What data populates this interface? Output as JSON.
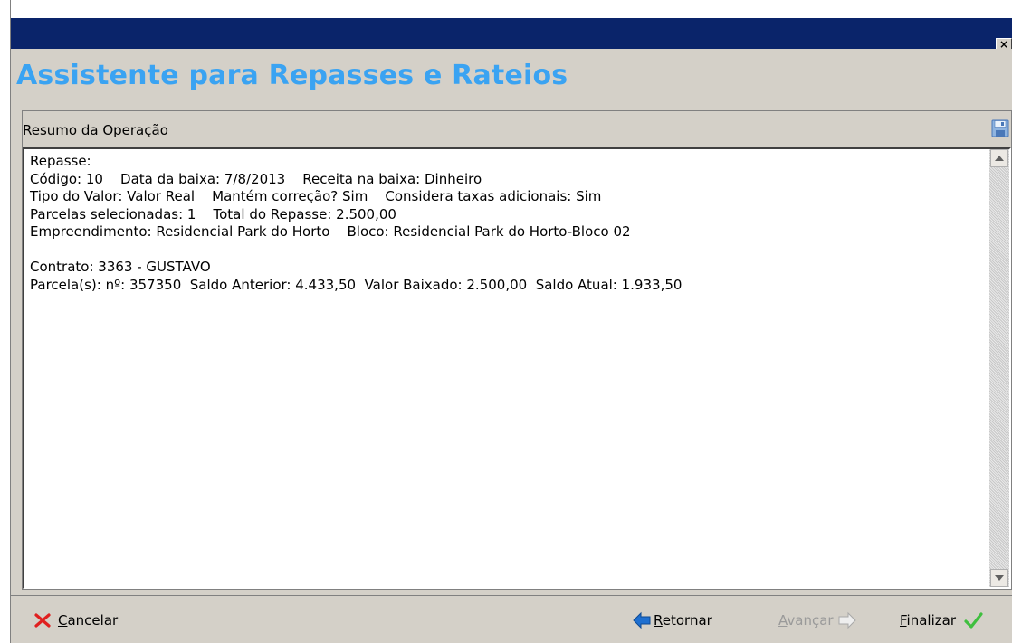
{
  "window": {
    "close_glyph": "×"
  },
  "header": {
    "title": "Assistente para Repasses e Rateios"
  },
  "panel": {
    "title": "Resumo da Operação",
    "save_icon": "save-icon",
    "lines": [
      "Repasse:",
      "Código: 10    Data da baixa: 7/8/2013    Receita na baixa: Dinheiro",
      "Tipo do Valor: Valor Real    Mantém correção? Sim    Considera taxas adicionais: Sim",
      "Parcelas selecionadas: 1    Total do Repasse: 2.500,00",
      "Empreendimento: Residencial Park do Horto    Bloco: Residencial Park do Horto-Bloco 02",
      "",
      "Contrato: 3363 - GUSTAVO",
      "Parcela(s): nº: 357350  Saldo Anterior: 4.433,50  Valor Baixado: 2.500,00  Saldo Atual: 1.933,50"
    ]
  },
  "footer": {
    "cancel_label": "Cancelar",
    "back_label": "Retornar",
    "next_label": "Avançar",
    "finish_label": "Finalizar"
  },
  "colors": {
    "title_blue": "#3aa3f2",
    "titlebar_navy": "#0a246a",
    "cancel_red": "#e02020",
    "finish_green": "#3fbf3f",
    "back_blue": "#1e6fd0"
  }
}
